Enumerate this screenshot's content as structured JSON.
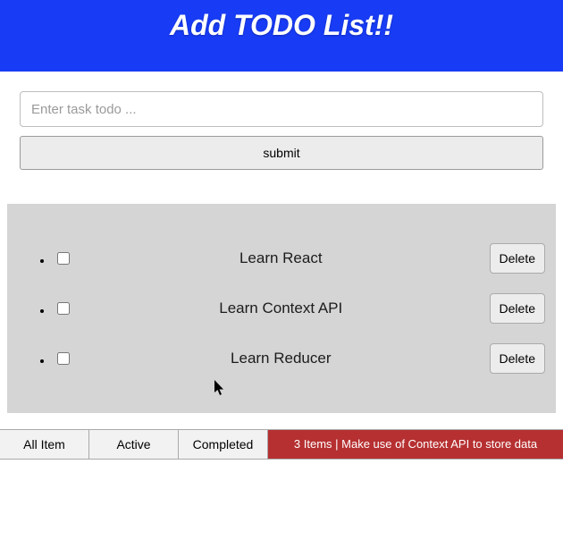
{
  "header": {
    "title": "Add TODO List!!"
  },
  "form": {
    "placeholder": "Enter task todo ...",
    "value": "",
    "submit_label": "submit"
  },
  "tasks": [
    {
      "text": "Learn React",
      "checked": false,
      "delete_label": "Delete"
    },
    {
      "text": "Learn Context API",
      "checked": false,
      "delete_label": "Delete"
    },
    {
      "text": "Learn Reducer",
      "checked": false,
      "delete_label": "Delete"
    }
  ],
  "filters": {
    "all": "All Item",
    "active": "Active",
    "completed": "Completed"
  },
  "status": {
    "text": "3 Items | Make use of Context API to store data",
    "count": 3,
    "color": "#b63031"
  }
}
